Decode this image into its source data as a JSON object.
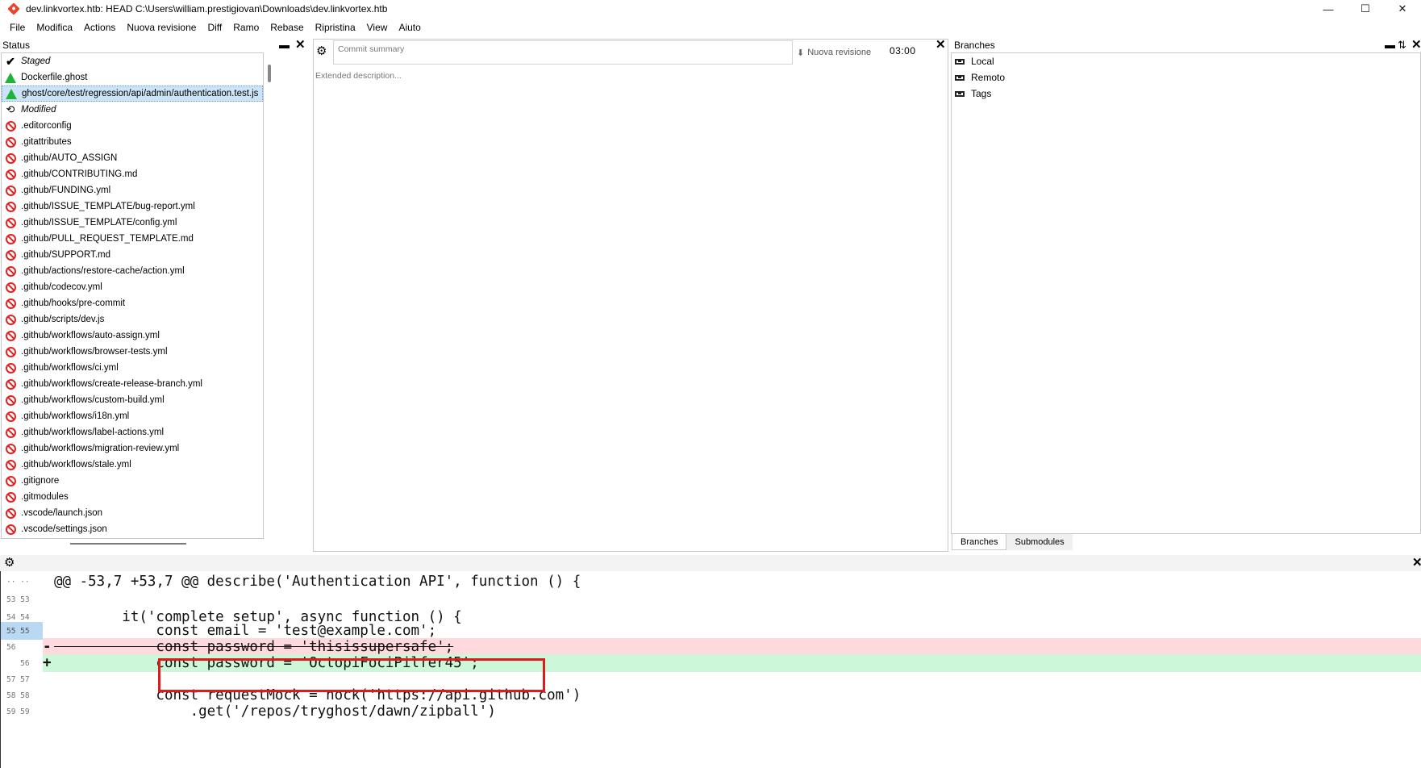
{
  "window": {
    "title": "dev.linkvortex.htb: HEAD C:\\Users\\william.prestigiovan\\Downloads\\dev.linkvortex.htb",
    "minimize": "—",
    "maximize": "☐",
    "close": "✕"
  },
  "menu": [
    "File",
    "Modifica",
    "Actions",
    "Nuova revisione",
    "Diff",
    "Ramo",
    "Rebase",
    "Ripristina",
    "View",
    "Aiuto"
  ],
  "status_panel": {
    "title": "Status",
    "staged_header": "Staged",
    "staged": [
      "Dockerfile.ghost",
      "ghost/core/test/regression/api/admin/authentication.test.js"
    ],
    "modified_header": "Modified",
    "modified": [
      ".editorconfig",
      ".gitattributes",
      ".github/AUTO_ASSIGN",
      ".github/CONTRIBUTING.md",
      ".github/FUNDING.yml",
      ".github/ISSUE_TEMPLATE/bug-report.yml",
      ".github/ISSUE_TEMPLATE/config.yml",
      ".github/PULL_REQUEST_TEMPLATE.md",
      ".github/SUPPORT.md",
      ".github/actions/restore-cache/action.yml",
      ".github/codecov.yml",
      ".github/hooks/pre-commit",
      ".github/scripts/dev.js",
      ".github/workflows/auto-assign.yml",
      ".github/workflows/browser-tests.yml",
      ".github/workflows/ci.yml",
      ".github/workflows/create-release-branch.yml",
      ".github/workflows/custom-build.yml",
      ".github/workflows/i18n.yml",
      ".github/workflows/label-actions.yml",
      ".github/workflows/migration-review.yml",
      ".github/workflows/stale.yml",
      ".gitignore",
      ".gitmodules",
      ".vscode/launch.json",
      ".vscode/settings.json"
    ]
  },
  "commit_panel": {
    "summary_placeholder": "Commit summary",
    "commit_button": "Nuova revisione",
    "timer": "03:00",
    "description_placeholder": "Extended description..."
  },
  "branches_panel": {
    "title": "Branches",
    "items": [
      "Local",
      "Remoto",
      "Tags"
    ],
    "tabs": [
      "Branches",
      "Submodules"
    ]
  },
  "diff": {
    "lines": [
      {
        "old": "··",
        "new": "··",
        "kind": "hunk",
        "text": "@@ -53,7 +53,7 @@ describe('Authentication API', function () {"
      },
      {
        "old": "53",
        "new": "53",
        "kind": "context",
        "text": ""
      },
      {
        "old": "54",
        "new": "54",
        "kind": "context",
        "text": "        it('complete setup', async function () {"
      },
      {
        "old": "55",
        "new": "55",
        "kind": "context",
        "text": "            const email = 'test@example.com';"
      },
      {
        "old": "56",
        "new": "",
        "kind": "removed",
        "marker": "-",
        "text": "            const password = 'thisissupersafe';"
      },
      {
        "old": "",
        "new": "56",
        "kind": "added",
        "marker": "+",
        "text": "            const password = 'OctopiFociPilfer45';"
      },
      {
        "old": "57",
        "new": "57",
        "kind": "context",
        "text": ""
      },
      {
        "old": "58",
        "new": "58",
        "kind": "context",
        "text": "            const requestMock = nock('https://api.github.com')"
      },
      {
        "old": "59",
        "new": "59",
        "kind": "context",
        "text": "                .get('/repos/tryghost/dawn/zipball')"
      }
    ]
  },
  "icons": {
    "gear": "⚙",
    "close": "✕",
    "check": "✔",
    "modified": "⟲",
    "download": "⬇",
    "dock": "▬",
    "sort": "⇅"
  },
  "colors": {
    "removed_bg": "#ffd9dd",
    "added_bg": "#ccf7d8",
    "selection": "#cde4f7",
    "highlight_border": "#e01a1a",
    "staged_icon": "#1db43a",
    "modified_icon": "#e02424"
  }
}
